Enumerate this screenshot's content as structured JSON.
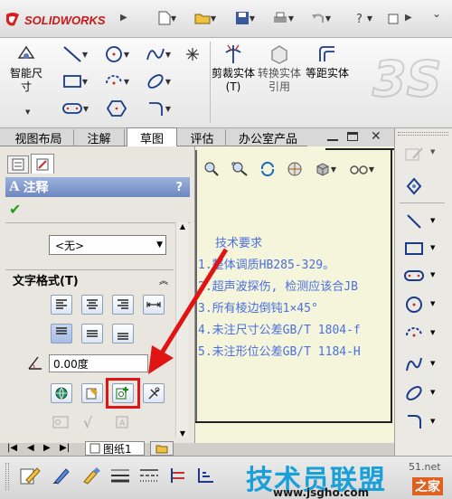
{
  "app": {
    "logo_text": "SOLIDWORKS",
    "watermark_text": "3S"
  },
  "ribbon": {
    "smart_dimension_label": "智能尺寸",
    "trim_label": "剪裁实体(T)",
    "convert_label": "转换实体引用",
    "offset_label": "等距实体"
  },
  "tabs": [
    {
      "label": "视图布局"
    },
    {
      "label": "注解"
    },
    {
      "label": "草图"
    },
    {
      "label": "评估"
    },
    {
      "label": "办公室产品"
    }
  ],
  "property_manager": {
    "title": "注释",
    "help": "?",
    "dropdown_value": "<无>",
    "section_title": "文字格式(T)",
    "angle_value": "0.00度"
  },
  "note": {
    "lines": [
      "技术要求",
      "1.整体调质HB285-329。",
      "2.超声波探伤, 检测应该合JB",
      "3.所有棱边倒钝1×45°",
      "4.未注尺寸公差GB/T 1804-f",
      "5.未注形位公差GB/T 1184-H"
    ]
  },
  "bottom_tabs": {
    "sheet_tab": "图纸1"
  },
  "site_watermark": {
    "main": "技术员联盟",
    "url": "www.jsgho.com",
    "suffix": "51.net",
    "corner": "之家"
  },
  "colors": {
    "accent_red": "#e01414",
    "note_blue": "#4a6fe0",
    "panel_title_bg": "#7a96c8"
  }
}
